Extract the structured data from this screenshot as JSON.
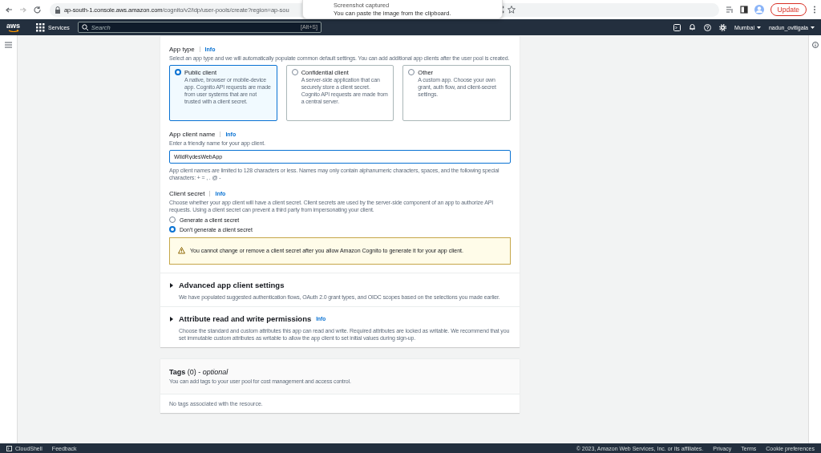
{
  "browser": {
    "url_host": "ap-south-1.console.aws.amazon.com",
    "url_path": "/cognito/v2/idp/user-pools/create?region=ap-sou",
    "update_button": "Update"
  },
  "notification": {
    "title": "Screenshot captured",
    "message": "You can paste the image from the clipboard."
  },
  "nav": {
    "logo": "aws",
    "services": "Services",
    "search_placeholder": "Search",
    "search_shortcut": "[Alt+S]",
    "region": "Mumbai",
    "user": "nadun_ovitigala"
  },
  "app_type": {
    "label": "App type",
    "info": "Info",
    "description": "Select an app type and we will automatically populate common default settings. You can add additional app clients after the user pool is created.",
    "options": [
      {
        "title": "Public client",
        "description": "A native, browser or mobile-device app. Cognito API requests are made from user systems that are not trusted with a client secret.",
        "selected": true
      },
      {
        "title": "Confidential client",
        "description": "A server-side application that can securely store a client secret. Cognito API requests are made from a central server.",
        "selected": false
      },
      {
        "title": "Other",
        "description": "A custom app. Choose your own grant, auth flow, and client-secret settings.",
        "selected": false
      }
    ]
  },
  "app_client_name": {
    "label": "App client name",
    "info": "Info",
    "hint": "Enter a friendly name for your app client.",
    "value": "WildRydesWebApp",
    "constraint": "App client names are limited to 128 characters or less. Names may only contain alphanumeric characters, spaces, and the following special characters: + = , . @ -"
  },
  "client_secret": {
    "label": "Client secret",
    "info": "Info",
    "description": "Choose whether your app client will have a client secret. Client secrets are used by the server-side component of an app to authorize API requests. Using a client secret can prevent a third party from impersonating your client.",
    "options": [
      {
        "label": "Generate a client secret",
        "selected": false
      },
      {
        "label": "Don't generate a client secret",
        "selected": true
      }
    ],
    "warning": "You cannot change or remove a client secret after you allow Amazon Cognito to generate it for your app client."
  },
  "sections": [
    {
      "title": "Advanced app client settings",
      "description": "We have populated suggested authentication flows, OAuth 2.0 grant types, and OIDC scopes based on the selections you made earlier.",
      "expanded": false
    },
    {
      "title": "Attribute read and write permissions",
      "info": "Info",
      "description": "Choose the standard and custom attributes this app can read and write. Required attributes are locked as writable. We recommend that you set immutable custom attributes as writable to allow the app client to set initial values during sign-up.",
      "expanded": false
    }
  ],
  "tags": {
    "title": "**Tags** (0) - *optional*",
    "description": "You can add tags to your user pool for cost management and access control.",
    "empty": "No tags associated with the resource."
  },
  "footer": {
    "cloudshell": "CloudShell",
    "feedback": "Feedback",
    "copyright": "© 2023, Amazon Web Services, Inc. or its affiliates.",
    "links": [
      "Privacy",
      "Terms",
      "Cookie preferences"
    ]
  }
}
